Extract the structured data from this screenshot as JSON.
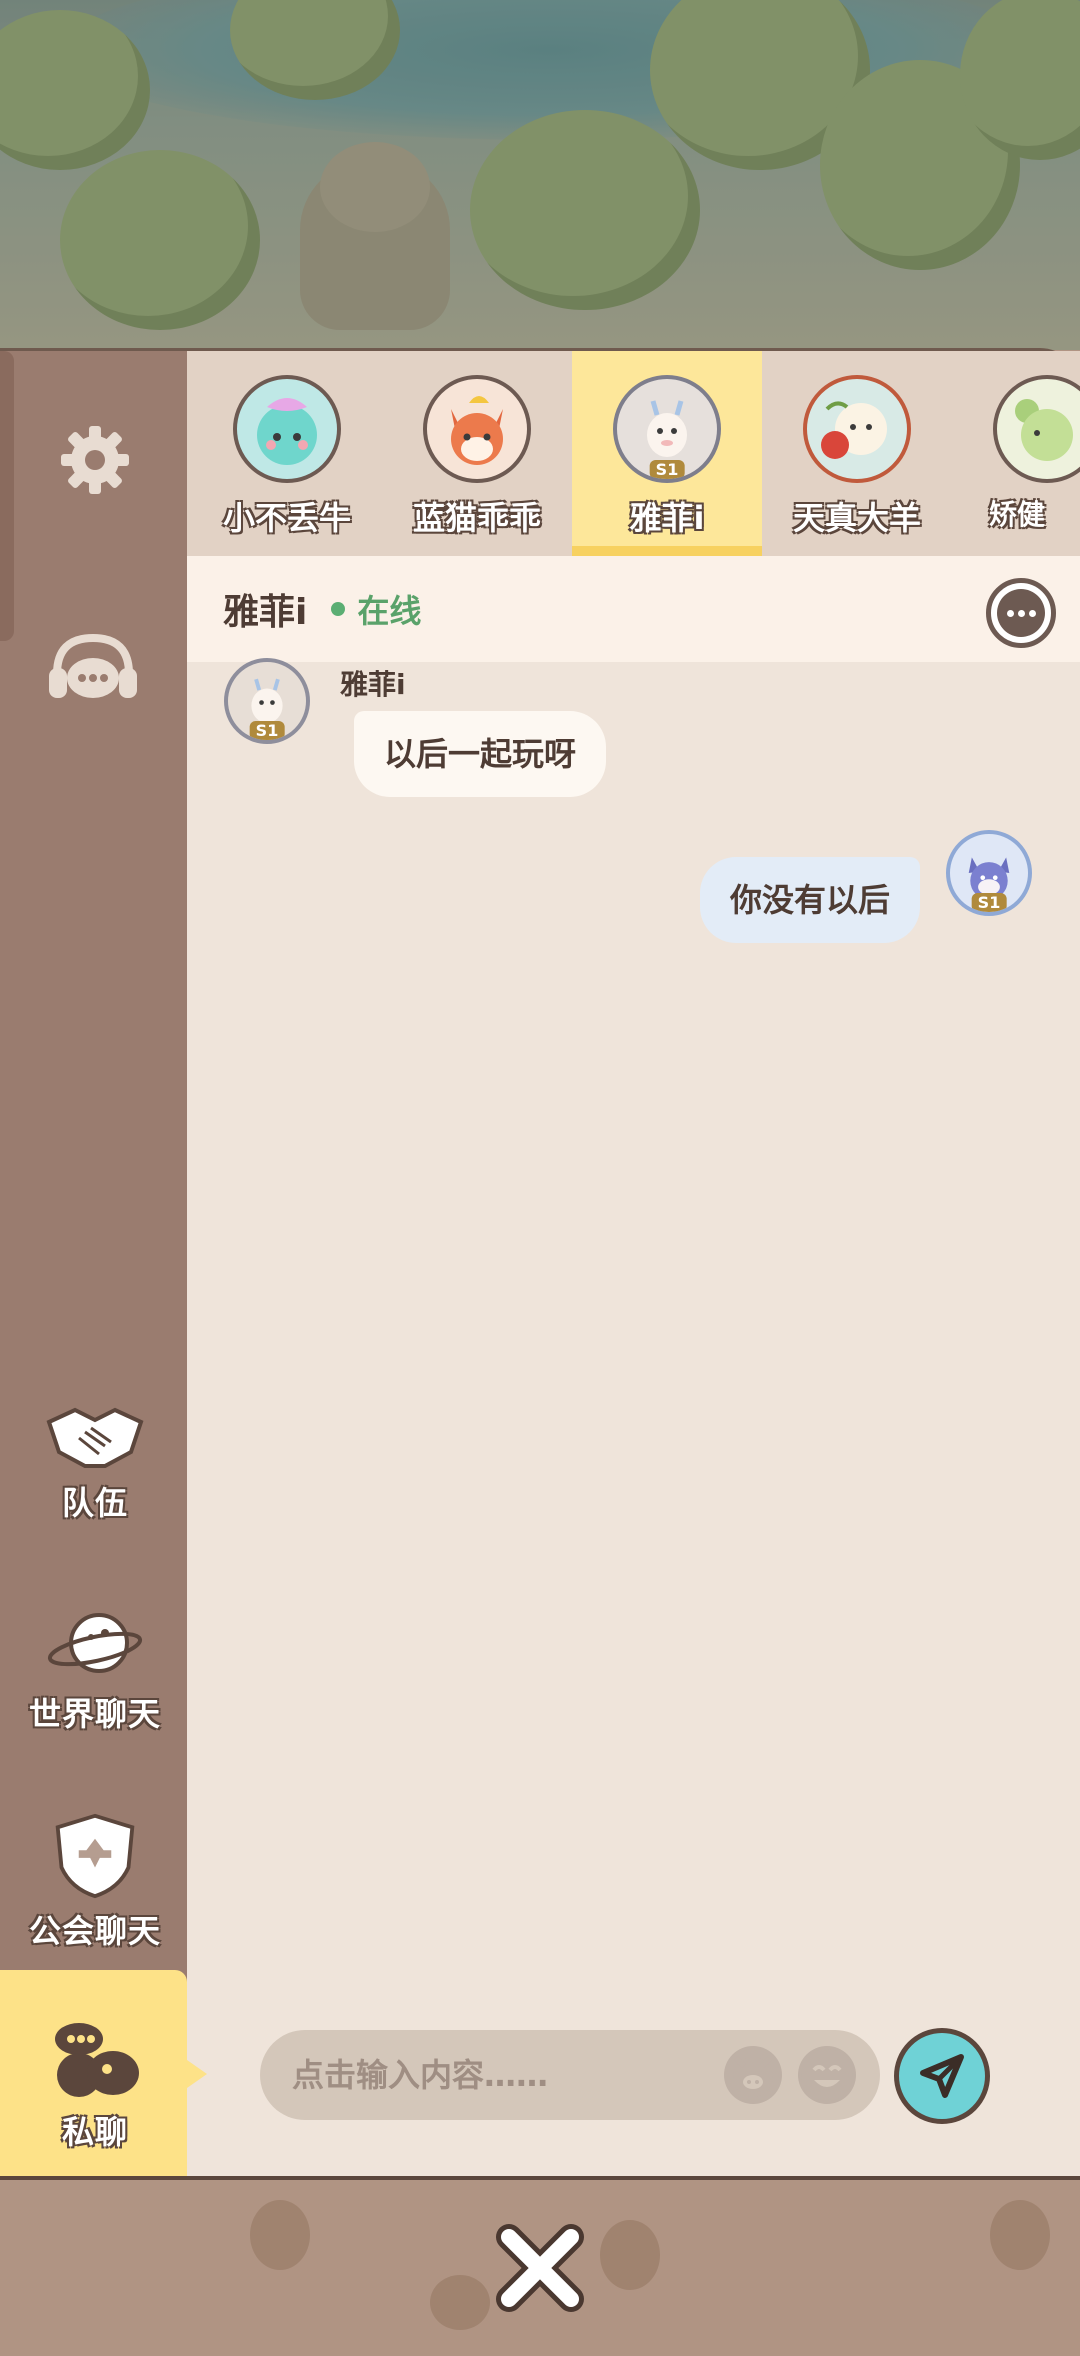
{
  "sidebar": {
    "team_label": "队伍",
    "world_label": "世界聊天",
    "guild_label": "公会聊天",
    "private_label": "私聊"
  },
  "friends": [
    {
      "name": "小不丢牛"
    },
    {
      "name": "蓝猫乖乖"
    },
    {
      "name": "雅菲i",
      "badge": "S1"
    },
    {
      "name": "天真大羊"
    },
    {
      "name": "矫健"
    }
  ],
  "chat": {
    "title": "雅菲i",
    "status": "在线",
    "messages": [
      {
        "sender": "雅菲i",
        "text": "以后一起玩呀",
        "badge": "S1"
      },
      {
        "text": "你没有以后",
        "badge": "S1"
      }
    ]
  },
  "input": {
    "placeholder": "点击输入内容……"
  },
  "colors": {
    "online": "#5aa26a",
    "active_tab": "#fde79a",
    "send_button": "#6fd2d6"
  }
}
